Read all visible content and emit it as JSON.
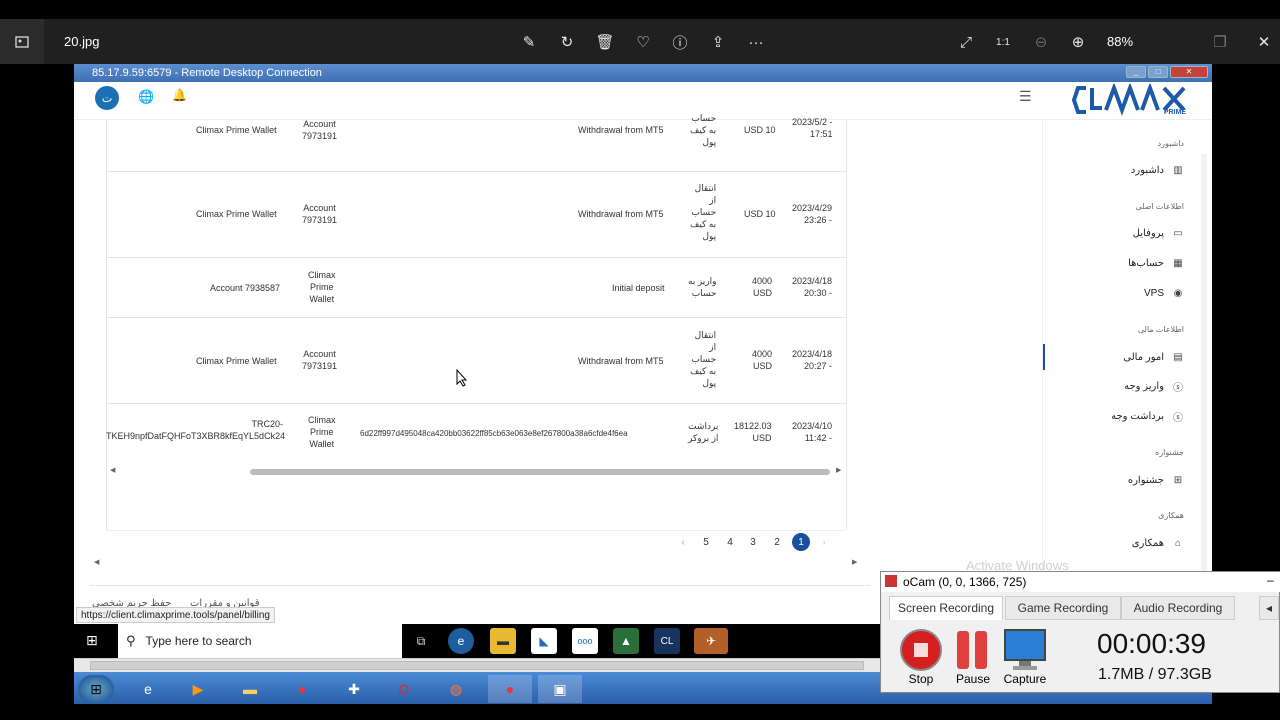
{
  "viewer": {
    "filename": "20.jpg",
    "zoom": "88%"
  },
  "rdp": {
    "title": "85.17.9.59:6579 - Remote Desktop Connection"
  },
  "header": {
    "logo_text": "PRIME"
  },
  "sidebar": {
    "sections": [
      {
        "label": "داشبورد"
      },
      {
        "label": "اطلاعات اصلی"
      },
      {
        "label": "اطلاعات مالی"
      },
      {
        "label": "جشنواره"
      },
      {
        "label": "همکاری"
      }
    ],
    "items": [
      {
        "label": "داشبورد"
      },
      {
        "label": "پروفایل"
      },
      {
        "label": "حساب‌ها"
      },
      {
        "label": "VPS"
      },
      {
        "label": "امور مالی"
      },
      {
        "label": "واریز وجه"
      },
      {
        "label": "برداشت وجه"
      },
      {
        "label": "جشنواره"
      },
      {
        "label": "همکاری"
      }
    ]
  },
  "table": {
    "rows": [
      {
        "date": "2023/5/2 -\n17:51",
        "amount": "USD 10",
        "type": "حساب\nبه کیف\nپول",
        "desc": "Withdrawal from MT5",
        "txid": "",
        "from": "Account\n7973191",
        "to": "Climax Prime Wallet"
      },
      {
        "date": "2023/4/29\n23:26 -",
        "amount": "USD 10",
        "type": "انتقال\nاز\nحساب\nبه کیف\nپول",
        "desc": "Withdrawal from MT5",
        "txid": "",
        "from": "Account\n7973191",
        "to": "Climax Prime Wallet"
      },
      {
        "date": "2023/4/18\n20:30 -",
        "amount": "4000\nUSD",
        "type": "واریز به\nحساب",
        "desc": "Initial deposit",
        "txid": "",
        "from": "Climax\nPrime\nWallet",
        "to": "Account 7938587"
      },
      {
        "date": "2023/4/18\n20:27 -",
        "amount": "4000\nUSD",
        "type": "انتقال\nاز\nحساب\nبه کیف\nپول",
        "desc": "Withdrawal from MT5",
        "txid": "",
        "from": "Account\n7973191",
        "to": "Climax Prime Wallet"
      },
      {
        "date": "2023/4/10\n11:42 -",
        "amount": "18122.03\nUSD",
        "type": "برداشت\nاز بروکر",
        "desc": "",
        "txid": "6d22ff997d495048ca420bb03622ff85cb63e063e8ef267800a38a6cfde4f6ea",
        "from": "Climax\nPrime\nWallet",
        "to": "TRC20-\nTKEH9npfDatFQHFoT3XBR8kfEqYL5dCk24"
      }
    ],
    "pages": [
      "1",
      "2",
      "3",
      "4",
      "5"
    ],
    "active_page": "1"
  },
  "status_url": "https://client.climaxprime.tools/panel/billing",
  "footer_links": [
    "قوانین و مقررات",
    "حفظ حریم شخصی"
  ],
  "watermark": "Activate Windows",
  "remote_taskbar": {
    "search_placeholder": "Type here to search"
  },
  "ocam": {
    "title": "oCam (0, 0, 1366, 725)",
    "tabs": [
      "Screen Recording",
      "Game Recording",
      "Audio Recording"
    ],
    "buttons": [
      "Stop",
      "Pause",
      "Capture"
    ],
    "timer": "00:00:39",
    "size": "1.7MB / 97.3GB"
  },
  "colors": {
    "accent": "#1a4fa0",
    "stop_red": "#d42020"
  }
}
